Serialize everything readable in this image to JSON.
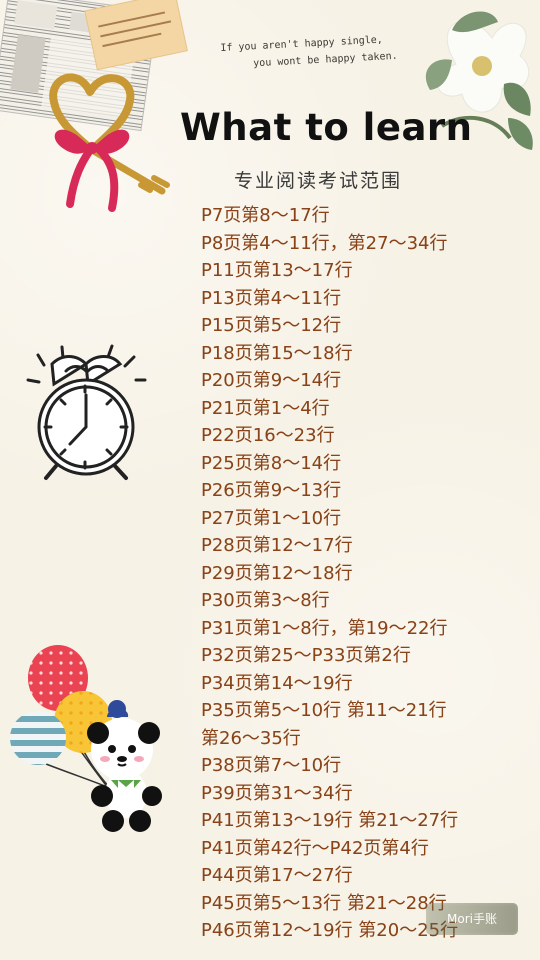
{
  "header": {
    "quote_line1": "If you aren't happy single,",
    "quote_line2": "you wont be happy taken.",
    "title": "What to learn",
    "subtitle": "专业阅读考试范围"
  },
  "reading_scope": {
    "items": [
      "P7页第8～17行",
      "P8页第4～11行，第27～34行",
      "P11页第13～17行",
      "P13页第4～11行",
      "P15页第5～12行",
      "P18页第15～18行",
      "P20页第9～14行",
      "P21页第1～4行",
      "P22页16～23行",
      "P25页第8～14行",
      "P26页第9～13行",
      "P27页第1～10行",
      "P28页第12～17行",
      "P29页第12～18行",
      "P30页第3～8行",
      "P31页第1～8行，第19～22行",
      "P32页第25～P33页第2行",
      "P34页第14～19行",
      "P35页第5～10行 第11～21行",
      "第26～35行",
      "P38页第7～10行",
      "P39页第31～34行",
      "P41页第13～19行 第21～27行",
      "P41页第42行～P42页第4行",
      "P44页第17～27行",
      "P45页第5～13行 第21～28行",
      "P46页第12～19行 第20～25行"
    ]
  },
  "decorations": {
    "newspaper_icon": "newspaper-icon",
    "heart_key_icon": "heart-key-icon",
    "flower_icon": "flower-icon",
    "alarm_clock_icon": "alarm-clock-icon",
    "balloons_panda_icon": "balloons-panda-icon"
  },
  "watermark": {
    "label": "Mori手账"
  },
  "colors": {
    "background": "#f7f2e6",
    "title": "#111111",
    "text": "#8a4318",
    "accent_red": "#d71f3a"
  }
}
